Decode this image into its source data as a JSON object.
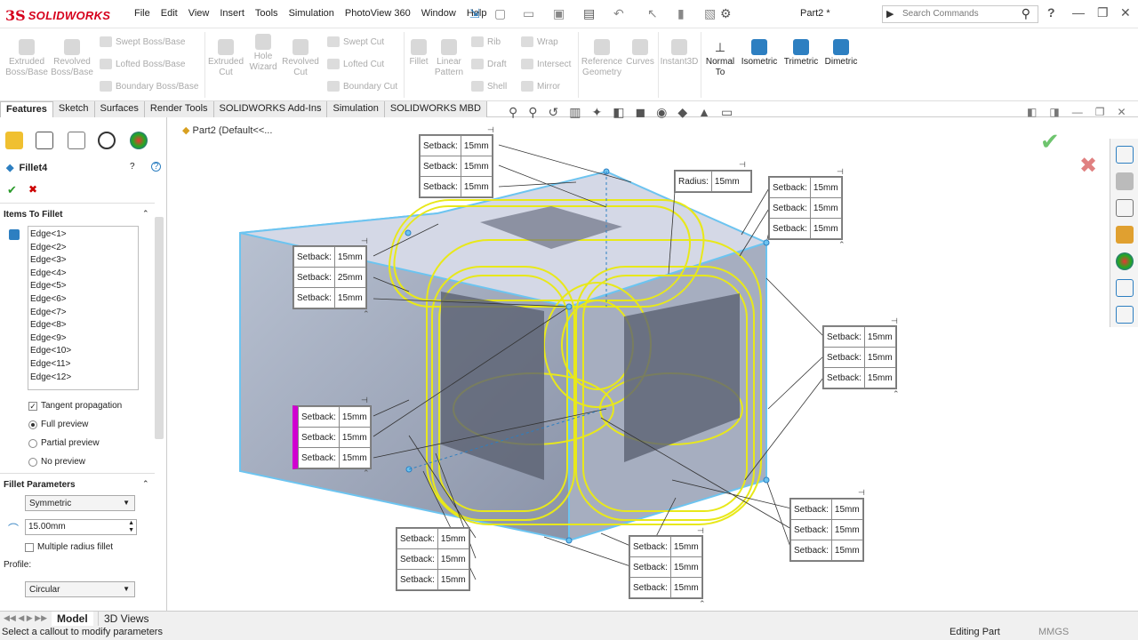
{
  "app": {
    "brand_ds": "3S",
    "brand_name": "SOLIDWORKS",
    "doc_title": "Part2 *",
    "search_placeholder": "Search Commands",
    "help": "?"
  },
  "menu": [
    "File",
    "Edit",
    "View",
    "Insert",
    "Tools",
    "Simulation",
    "PhotoView 360",
    "Window",
    "Help"
  ],
  "cmd": {
    "extruded_boss": "Extruded Boss/Base",
    "revolved_boss": "Revolved Boss/Base",
    "swept_boss": "Swept Boss/Base",
    "lofted_boss": "Lofted Boss/Base",
    "boundary_boss": "Boundary Boss/Base",
    "extruded_cut": "Extruded Cut",
    "hole_wizard": "Hole Wizard",
    "revolved_cut": "Revolved Cut",
    "swept_cut": "Swept Cut",
    "lofted_cut": "Lofted Cut",
    "boundary_cut": "Boundary Cut",
    "fillet": "Fillet",
    "linear_pattern": "Linear Pattern",
    "rib": "Rib",
    "draft": "Draft",
    "shell": "Shell",
    "wrap": "Wrap",
    "intersect": "Intersect",
    "mirror": "Mirror",
    "reference_geometry": "Reference Geometry",
    "curves": "Curves",
    "instant3d": "Instant3D",
    "normal_to": "Normal To",
    "isometric": "Isometric",
    "trimetric": "Trimetric",
    "dimetric": "Dimetric"
  },
  "tabs": [
    "Features",
    "Sketch",
    "Surfaces",
    "Render Tools",
    "SOLIDWORKS Add-Ins",
    "Simulation",
    "SOLIDWORKS MBD"
  ],
  "panel": {
    "title": "Fillet4",
    "items_header": "Items To Fillet",
    "edges": [
      "Edge<1>",
      "Edge<2>",
      "Edge<3>",
      "Edge<4>",
      "Edge<5>",
      "Edge<6>",
      "Edge<7>",
      "Edge<8>",
      "Edge<9>",
      "Edge<10>",
      "Edge<11>",
      "Edge<12>"
    ],
    "tangent": "Tangent propagation",
    "full": "Full preview",
    "partial": "Partial preview",
    "none": "No preview",
    "params_header": "Fillet Parameters",
    "symmetric": "Symmetric",
    "radius": "15.00mm",
    "multi": "Multiple radius fillet",
    "profile_label": "Profile:",
    "profile": "Circular"
  },
  "bottom": {
    "model": "Model",
    "views3d": "3D Views",
    "status": "Select a callout to modify parameters",
    "editing": "Editing Part",
    "units": "MMGS"
  },
  "tree": {
    "part": "Part2",
    "config": "(Default<<..."
  },
  "callout_labels": {
    "setback": "Setback:",
    "radius": "Radius:"
  },
  "callouts": {
    "top": [
      "15mm",
      "15mm",
      "15mm"
    ],
    "radius": "15mm",
    "right_top": [
      "15mm",
      "15mm",
      "15mm"
    ],
    "left_top": [
      "15mm",
      "25mm",
      "15mm"
    ],
    "right_mid": [
      "15mm",
      "15mm",
      "15mm"
    ],
    "left_bot": [
      "15mm",
      "15mm",
      "15mm"
    ],
    "right_bot": [
      "15mm",
      "15mm",
      "15mm"
    ],
    "bottom_left": [
      "15mm",
      "15mm",
      "15mm"
    ],
    "bottom_mid": [
      "15mm",
      "15mm",
      "15mm"
    ]
  },
  "colors": {
    "accent": "#2d7fc1",
    "wire": "#e8e81a",
    "magenta": "#d000d0",
    "check": "#6ec46e",
    "cancel": "#e08080"
  }
}
